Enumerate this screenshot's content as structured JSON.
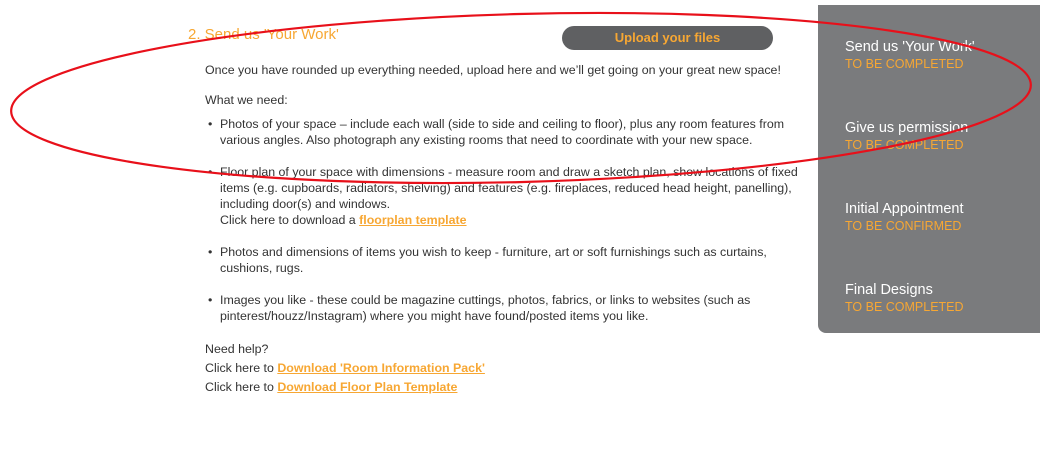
{
  "section": {
    "title": "2. Send us 'Your Work'",
    "upload_label": "Upload your files",
    "intro": "Once you have rounded up everything needed, upload here and we’ll get going on your great new space!",
    "need_label": "What we need:",
    "needs": [
      {
        "text": "Photos of your space – include each wall (side to side and ceiling to floor), plus any room features from various angles. Also photograph any existing rooms that need to coordinate with your new space."
      },
      {
        "text": "Floor plan of your space with dimensions - measure room and draw a sketch plan, show locations of fixed items (e.g. cupboards, radiators, shelving) and features (e.g. fireplaces, reduced head height, panelling), including door(s) and windows.",
        "link_prefix": "Click here to download a ",
        "link_text": "floorplan template"
      },
      {
        "text": "Photos and dimensions of items you wish to keep - furniture, art or soft furnishings such as curtains, cushions, rugs."
      },
      {
        "text": "Images you like - these could be magazine cuttings, photos, fabrics, or links to websites (such as pinterest/houzz/Instagram) where you might have found/posted items you like."
      }
    ],
    "help": {
      "title": "Need help?",
      "prefix": "Click here to ",
      "link1": "Download 'Room Information Pack'",
      "link2": "Download Floor Plan Template"
    },
    "bullet": "•"
  },
  "sidebar": {
    "steps": [
      {
        "title": "Send us 'Your Work'",
        "status": "TO BE COMPLETED"
      },
      {
        "title": "Give us permission",
        "status": "TO BE COMPLETED"
      },
      {
        "title": "Initial Appointment",
        "status": "TO BE CONFIRMED"
      },
      {
        "title": "Final Designs",
        "status": "TO BE COMPLETED"
      }
    ]
  },
  "colors": {
    "accent": "#f7a733",
    "sidebar_bg": "#7a7b7d",
    "button_bg": "#5f6062",
    "annotation": "#e8101a"
  }
}
